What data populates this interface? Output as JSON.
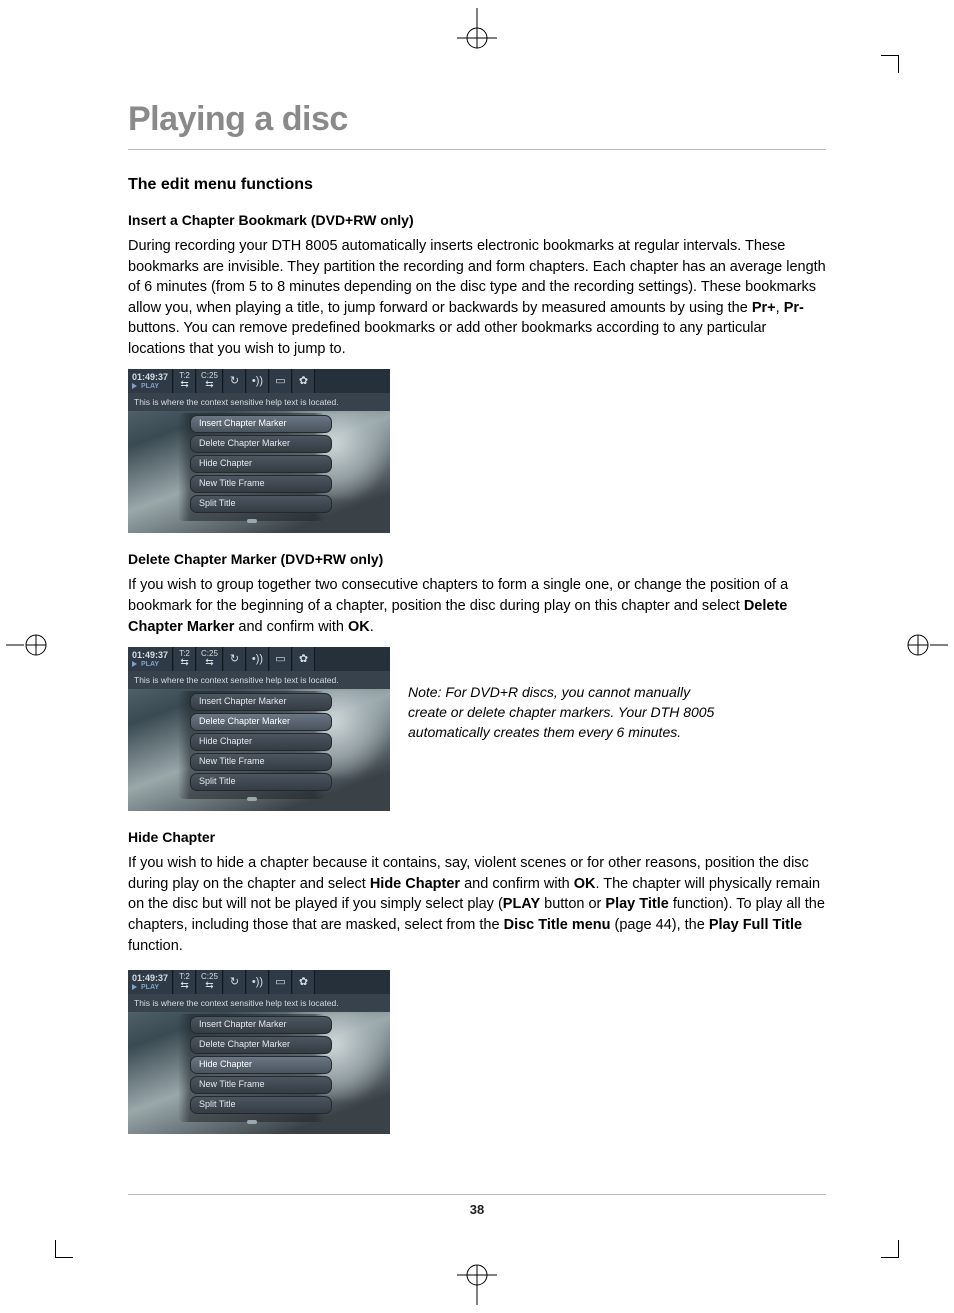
{
  "page": {
    "title": "Playing a disc",
    "section": "The edit menu functions",
    "number": "38"
  },
  "insert": {
    "heading": "Insert a Chapter Bookmark (DVD+RW only)",
    "body_html": "During recording your DTH 8005 automatically inserts electronic bookmarks at regular intervals. These bookmarks are invisible. They partition the recording and form chapters. Each chapter has an average length of 6 minutes (from 5 to 8 minutes depending on the disc type and the recording settings). These bookmarks allow you, when playing a title, to jump forward or backwards by measured amounts by using the <b>Pr+</b>, <b>Pr-</b> buttons. You can remove predefined bookmarks or add other bookmarks according to any particular locations that you wish to jump to."
  },
  "delete": {
    "heading": "Delete Chapter Marker (DVD+RW only)",
    "body_html": "If you wish to group together two consecutive chapters to form a single one, or change the position of a bookmark for the beginning of a chapter, position the disc during play on this chapter and select <b>Delete Chapter Marker</b> and confirm with <b>OK</b>.",
    "note": "Note: For DVD+R discs, you cannot manually create or delete chapter markers. Your DTH 8005 automatically creates them every 6 minutes."
  },
  "hide": {
    "heading": "Hide Chapter",
    "body_html": "If you wish to hide a chapter because it contains, say, violent scenes or for other reasons, position the disc during play on the chapter and select <b>Hide Chapter</b> and confirm with <b>OK</b>. The chapter will physically remain on the disc but will not be played if you simply select play (<b>PLAY</b> button or <b>Play Title</b> function). To play all the chapters, including those that are masked, select from the <b>Disc Title menu</b> (page 44), the <b>Play Full Title</b> function."
  },
  "osd": {
    "time": "01:49:37",
    "state": "PLAY",
    "t_label": "T:2",
    "c_label": "C:25",
    "helptext": "This is where the context sensitive help text is located.",
    "menu": [
      "Insert Chapter Marker",
      "Delete Chapter Marker",
      "Hide Chapter",
      "New Title Frame",
      "Split Title"
    ],
    "selected": {
      "fig1": 0,
      "fig2": 1,
      "fig3": 2
    },
    "icons": [
      "↻",
      "•))",
      "▭",
      "✿"
    ]
  }
}
